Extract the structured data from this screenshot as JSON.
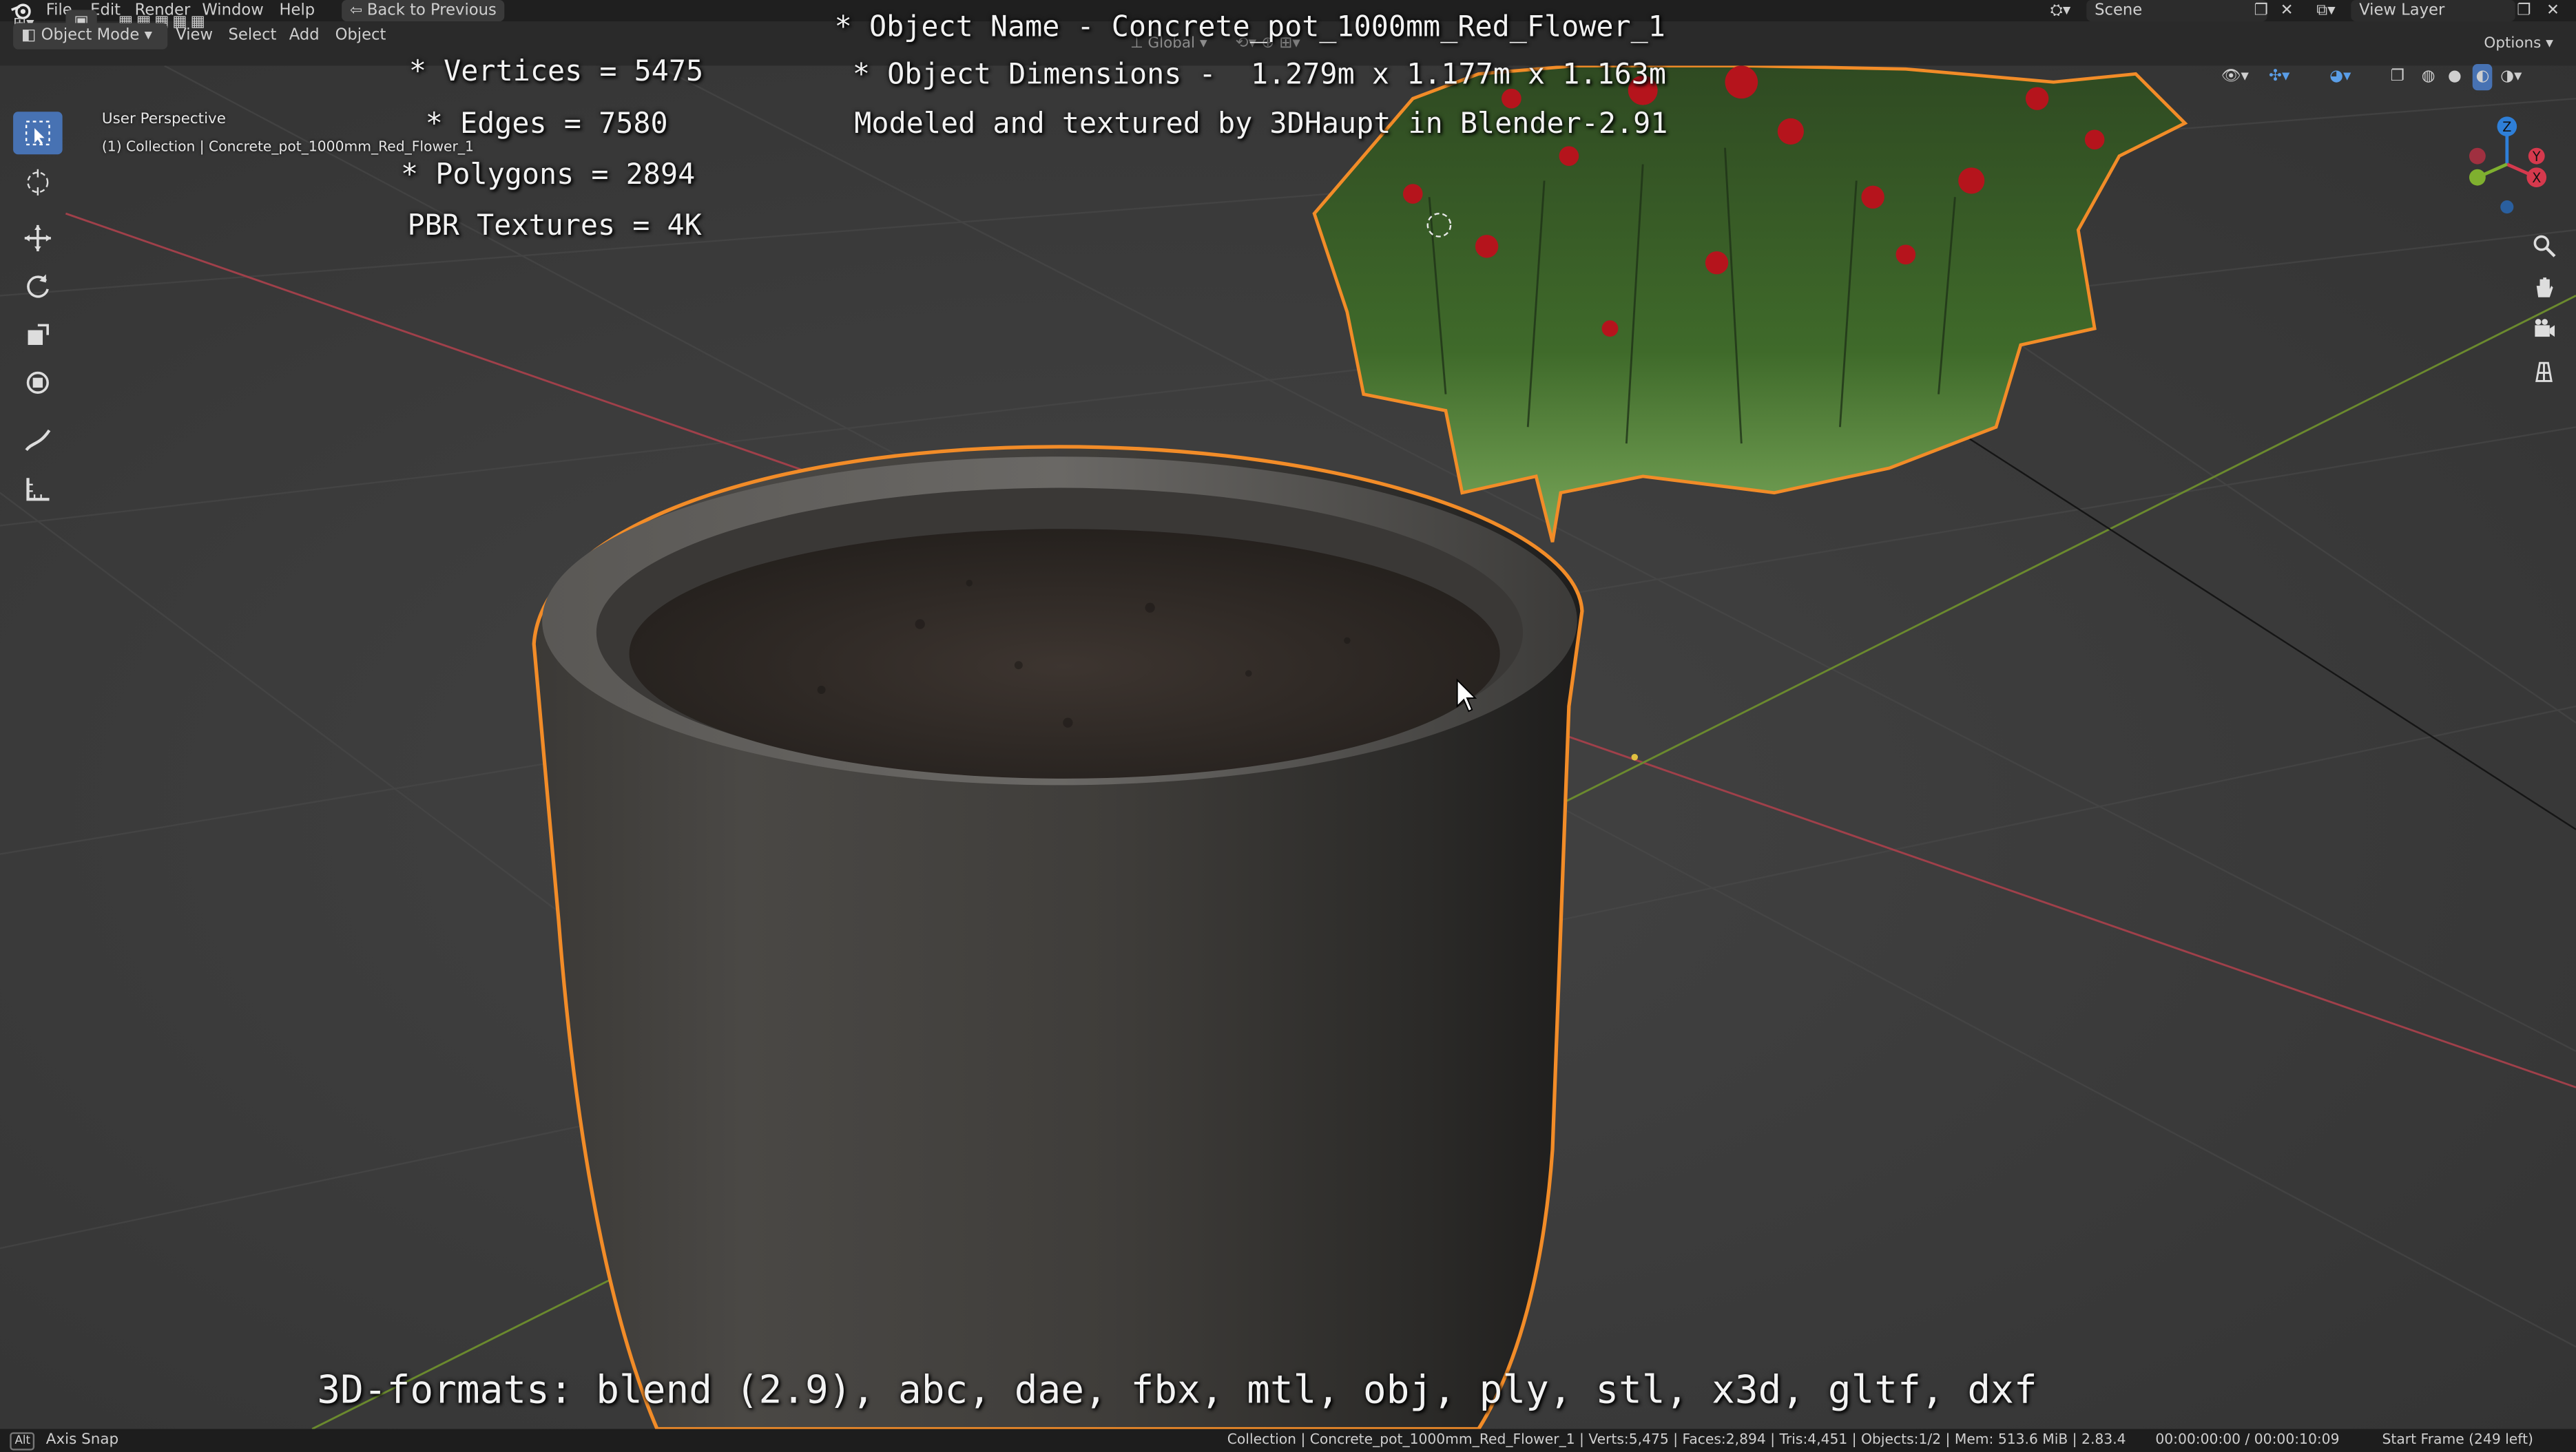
{
  "topbar": {
    "menus": [
      "File",
      "Edit",
      "Render",
      "Window",
      "Help"
    ],
    "back_button": "Back to Previous",
    "scene": "Scene",
    "view_layer": "View Layer"
  },
  "header": {
    "mode": "Object Mode",
    "menus": [
      "View",
      "Select",
      "Add",
      "Object"
    ],
    "transform_orientation": "Global",
    "options": "Options"
  },
  "viewport": {
    "perspective": "User Perspective",
    "collection": "(1) Collection | Concrete_pot_1000mm_Red_Flower_1"
  },
  "overlay": {
    "vertices": "* Vertices = 5475",
    "edges": "* Edges = 7580",
    "polygons": "* Polygons = 2894",
    "textures": "PBR Textures = 4K",
    "object_name": "* Object Name - Concrete_pot_1000mm_Red_Flower_1",
    "dimensions": "* Object Dimensions -  1.279m x 1.177m x 1.163m",
    "credits": "Modeled and textured by 3DHaupt in Blender-2.91",
    "formats": "3D-formats: blend (2.9), abc, dae, fbx, mtl, obj, ply, stl, x3d, gltf, dxf"
  },
  "statusbar": {
    "left_key": "Alt",
    "left_text": "Axis Snap",
    "stats": "Collection | Concrete_pot_1000mm_Red_Flower_1 | Verts:5,475 | Faces:2,894 | Tris:4,451 | Objects:1/2 | Mem: 513.6 MiB | 2.83.4",
    "time": "00:00:00:00 / 00:00:10:09",
    "frame": "Start Frame (249 left)"
  },
  "gizmo": {
    "x": "X",
    "y": "Y",
    "z": "Z"
  },
  "colors": {
    "selection_outline": "#f28c28",
    "axis_x": "#d6394d",
    "axis_y": "#7fb02f",
    "axis_z": "#2e7fd8",
    "active_tool": "#4772b3"
  }
}
